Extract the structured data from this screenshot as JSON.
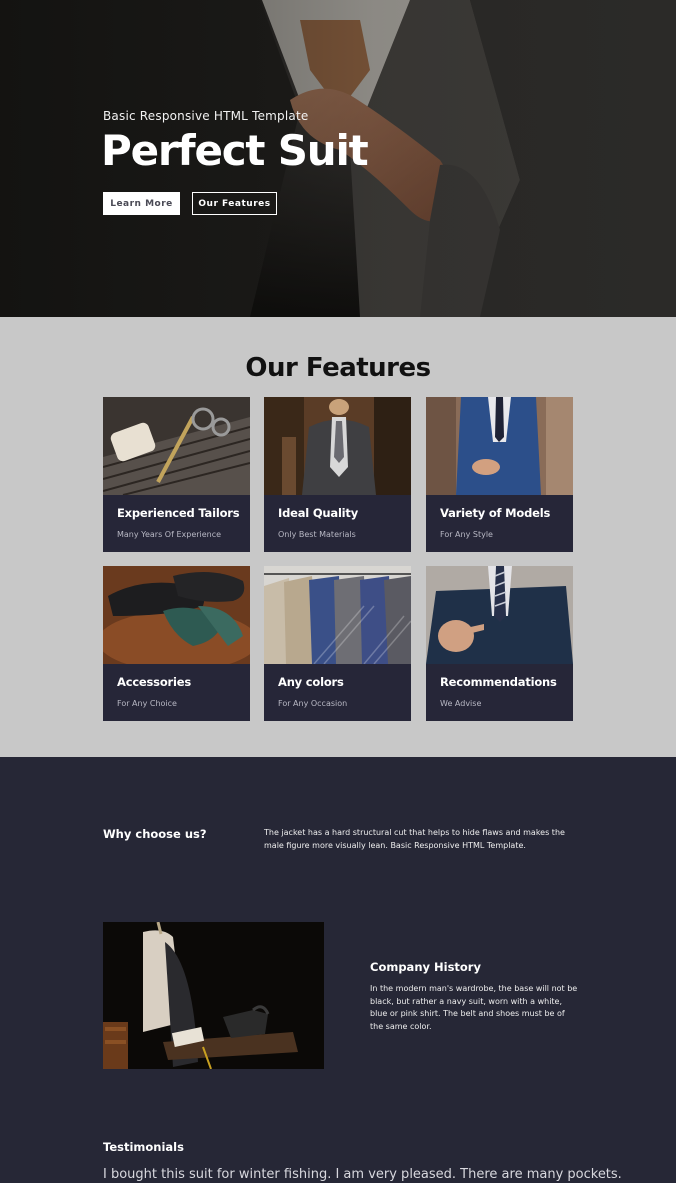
{
  "hero": {
    "subtitle": "Basic Responsive HTML Template",
    "title": "Perfect Suit",
    "buttons": {
      "learn_more": "Learn More",
      "our_features": "Our Features"
    }
  },
  "features": {
    "title": "Our Features",
    "cards": [
      {
        "title": "Experienced Tailors",
        "subtitle": "Many Years Of Experience"
      },
      {
        "title": "Ideal Quality",
        "subtitle": "Only Best Materials"
      },
      {
        "title": "Variety of Models",
        "subtitle": "For Any Style"
      },
      {
        "title": "Accessories",
        "subtitle": "For Any Choice"
      },
      {
        "title": "Any colors",
        "subtitle": "For Any Occasion"
      },
      {
        "title": "Recommendations",
        "subtitle": "We Advise"
      }
    ]
  },
  "why": {
    "title": "Why choose us?",
    "text": "The jacket has a hard structural cut that helps to hide flaws and makes the male figure more visually lean. Basic Responsive HTML Template."
  },
  "history": {
    "title": "Company History",
    "text": "In the modern man's wardrobe, the base will not be black, but rather a navy suit, worn with a white, blue or pink shirt. The belt and shoes must be of the same color."
  },
  "testimonials": {
    "title": "Testimonials",
    "text": "I bought this suit for winter fishing. I am very pleased. There are many pockets."
  },
  "colors": {
    "dark_navy": "#262638",
    "features_bg": "#c8c8c8"
  }
}
